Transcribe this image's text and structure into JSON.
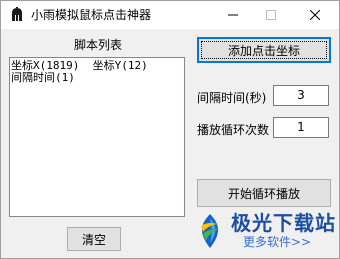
{
  "window": {
    "title": "小雨模拟鼠标点击神器",
    "icon": "spartan-helmet-icon",
    "controls": [
      "minimize-icon",
      "maximize-icon",
      "close-icon"
    ]
  },
  "script_list": {
    "label": "脚本列表",
    "lines": [
      "坐标X(1819)  坐标Y(12)",
      "间隔时间(1)"
    ]
  },
  "buttons": {
    "add_coord": "添加点击坐标",
    "start_loop": "开始循环播放",
    "clear": "清空"
  },
  "fields": {
    "interval_label": "间隔时间(秒)",
    "interval_value": "3",
    "loop_label": "播放循环次数",
    "loop_value": "1"
  },
  "watermark": {
    "name": "极光下载站",
    "sub": "更多软件>>",
    "color": "#1d4f9e"
  }
}
